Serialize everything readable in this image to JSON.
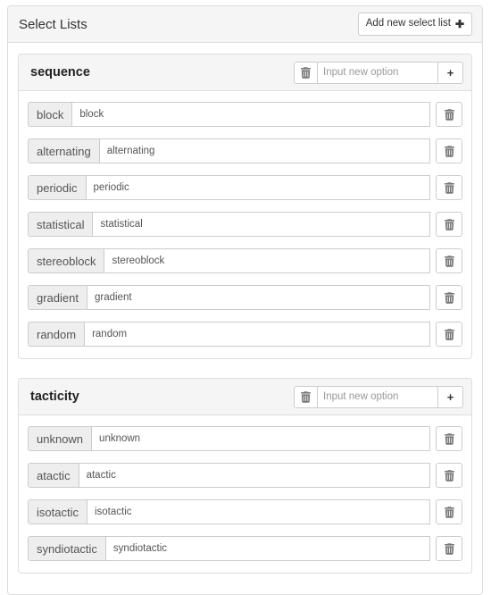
{
  "header": {
    "title": "Select Lists",
    "add_button_label": "Add new select list",
    "add_button_icon": "plus-icon"
  },
  "colors": {
    "panel_border": "#dddddd",
    "heading_bg": "#f5f5f5",
    "addon_bg": "#eeeeee",
    "text": "#333333",
    "placeholder": "#999999"
  },
  "add_option": {
    "placeholder": "Input new option",
    "delete_icon": "trash-icon",
    "add_icon": "plus-icon",
    "add_label": "+"
  },
  "row_icons": {
    "delete_icon": "trash-icon"
  },
  "lists": [
    {
      "name": "sequence",
      "new_option_value": "",
      "options": [
        {
          "label": "block",
          "value": "block"
        },
        {
          "label": "alternating",
          "value": "alternating"
        },
        {
          "label": "periodic",
          "value": "periodic"
        },
        {
          "label": "statistical",
          "value": "statistical"
        },
        {
          "label": "stereoblock",
          "value": "stereoblock"
        },
        {
          "label": "gradient",
          "value": "gradient"
        },
        {
          "label": "random",
          "value": "random"
        }
      ]
    },
    {
      "name": "tacticity",
      "new_option_value": "",
      "options": [
        {
          "label": "unknown",
          "value": "unknown"
        },
        {
          "label": "atactic",
          "value": "atactic"
        },
        {
          "label": "isotactic",
          "value": "isotactic"
        },
        {
          "label": "syndiotactic",
          "value": "syndiotactic"
        }
      ]
    }
  ]
}
